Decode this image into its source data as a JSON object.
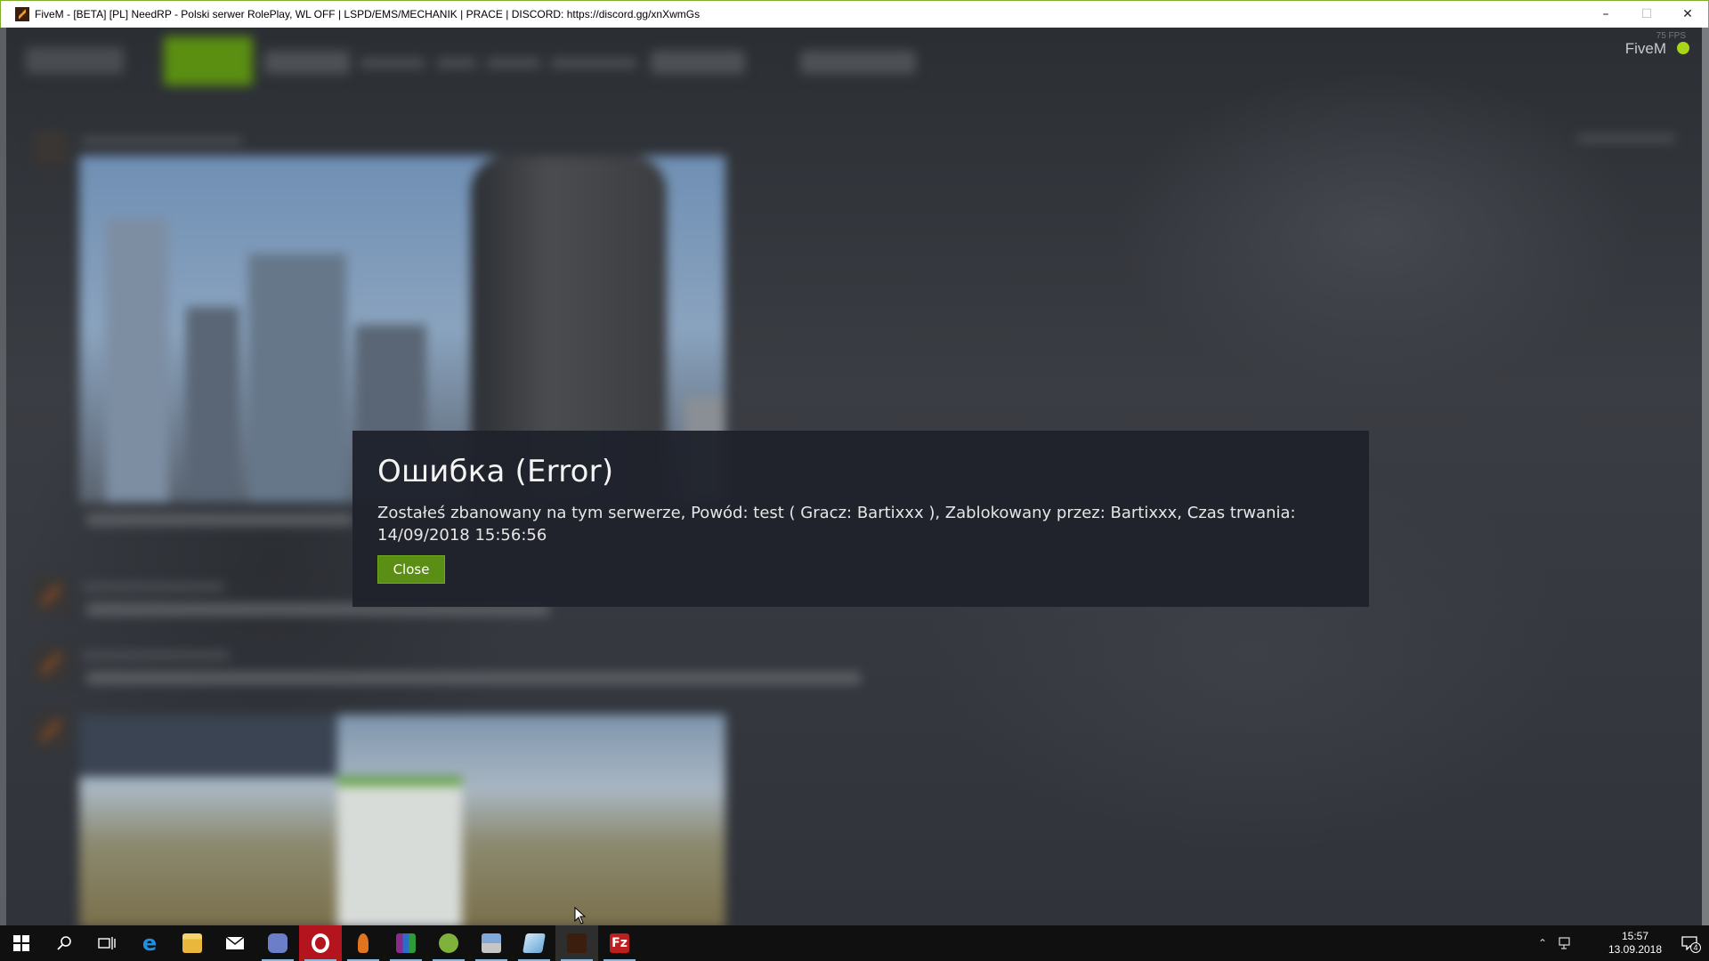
{
  "window": {
    "title": "FiveM - [BETA] [PL] NeedRP - Polski serwer RolePlay, WL OFF | LSPD/EMS/MECHANIK | PRACE | DISCORD: https://discord.gg/xnXwmGs",
    "controls": {
      "minimize": "–",
      "maximize": "☐",
      "close": "✕"
    }
  },
  "app": {
    "nav": {
      "brand": "FiveM",
      "fps": "75 FPS"
    }
  },
  "dialog": {
    "title": "Ошибка (Error)",
    "message": "Zostałeś zbanowany na tym serwerze, Powód: test ( Gracz: Bartixxx ), Zablokowany przez: Bartixxx, Czas trwania: 14/09/2018 15:56:56",
    "close_label": "Close",
    "accent_color": "#5a8e14"
  },
  "taskbar": {
    "apps": [
      {
        "name": "search-icon"
      },
      {
        "name": "task-view-icon"
      },
      {
        "name": "edge-icon"
      },
      {
        "name": "file-explorer-icon"
      },
      {
        "name": "mail-icon"
      },
      {
        "name": "game-app-icon"
      },
      {
        "name": "opera-icon"
      },
      {
        "name": "microphone-app-icon"
      },
      {
        "name": "winrar-icon"
      },
      {
        "name": "hs-app-icon"
      },
      {
        "name": "network-app-icon"
      },
      {
        "name": "notepad-icon"
      },
      {
        "name": "fivem-icon"
      },
      {
        "name": "filezilla-icon"
      }
    ],
    "clock": {
      "time": "15:57",
      "date": "13.09.2018"
    },
    "notifications_count": "4"
  }
}
